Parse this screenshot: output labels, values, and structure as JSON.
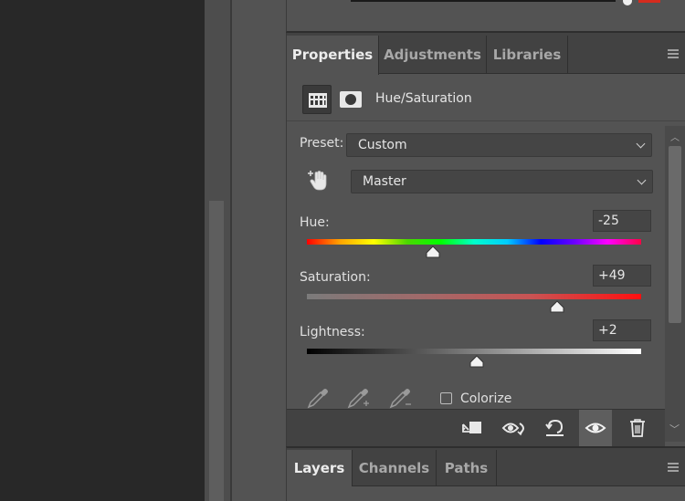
{
  "properties_panel": {
    "tabs": [
      {
        "label": "Properties",
        "active": true
      },
      {
        "label": "Adjustments",
        "active": false
      },
      {
        "label": "Libraries",
        "active": false
      }
    ],
    "icons": [
      "hue-saturation-adjustment-icon",
      "layer-mask-icon"
    ],
    "adjustment_title": "Hue/Saturation",
    "preset": {
      "label": "Preset:",
      "value": "Custom"
    },
    "channel": {
      "value": "Master"
    },
    "hue": {
      "label": "Hue:",
      "value": "-25",
      "slider_fraction": 0.38
    },
    "saturation": {
      "label": "Saturation:",
      "value": "+49",
      "slider_fraction": 0.75
    },
    "lightness": {
      "label": "Lightness:",
      "value": "+2",
      "slider_fraction": 0.51
    },
    "colorize": {
      "label": "Colorize",
      "checked": false
    },
    "eyedroppers": [
      "eyedropper-icon",
      "eyedropper-plus-icon",
      "eyedropper-minus-icon"
    ],
    "bottom_buttons": [
      "clip-to-layer-icon",
      "view-previous-state-icon",
      "reset-icon",
      "visibility-eye-icon",
      "delete-icon"
    ]
  },
  "layers_panel": {
    "tabs": [
      {
        "label": "Layers",
        "active": true
      },
      {
        "label": "Channels",
        "active": false
      },
      {
        "label": "Paths",
        "active": false
      }
    ]
  },
  "colors": {
    "panel_bg": "#535353",
    "tabbar_bg": "#424242",
    "canvas_bg": "#282828",
    "accent_red": "#d52b1e"
  }
}
